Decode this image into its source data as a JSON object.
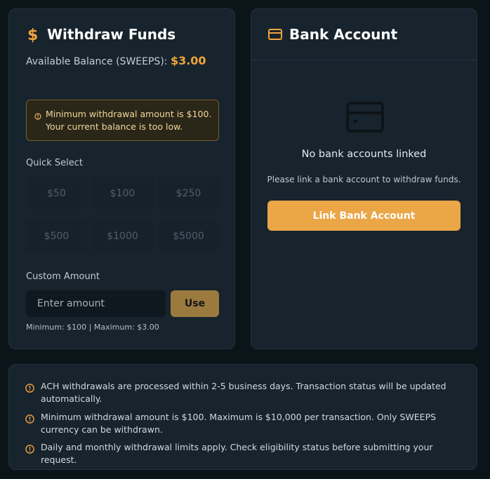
{
  "withdraw": {
    "title": "Withdraw Funds",
    "title_icon": "dollar-icon",
    "balance_label": "Available Balance (SWEEPS):",
    "balance_value": "$3.00",
    "warning_line1": "Minimum withdrawal amount is $100.",
    "warning_line2": "Your current balance is too low.",
    "quick_select_label": "Quick Select",
    "quick_amounts": [
      "$50",
      "$100",
      "$250",
      "$500",
      "$1000",
      "$5000"
    ],
    "custom_amount_label": "Custom Amount",
    "amount_placeholder": "Enter amount",
    "use_button": "Use",
    "limits_text": "Minimum: $100 | Maximum: $3.00"
  },
  "bank": {
    "title": "Bank Account",
    "title_icon": "credit-card-icon",
    "empty_title": "No bank accounts linked",
    "empty_subtitle": "Please link a bank account to withdraw funds.",
    "link_button": "Link Bank Account"
  },
  "info": {
    "items": [
      "ACH withdrawals are processed within 2-5 business days. Transaction status will be updated automatically.",
      "Minimum withdrawal amount is $100. Maximum is $10,000 per transaction. Only SWEEPS currency can be withdrawn.",
      "Daily and monthly withdrawal limits apply. Check eligibility status before submitting your request."
    ]
  },
  "colors": {
    "accent": "#f0a53a",
    "background": "#0b1419",
    "card": "#17232d",
    "button": "#eba646"
  }
}
